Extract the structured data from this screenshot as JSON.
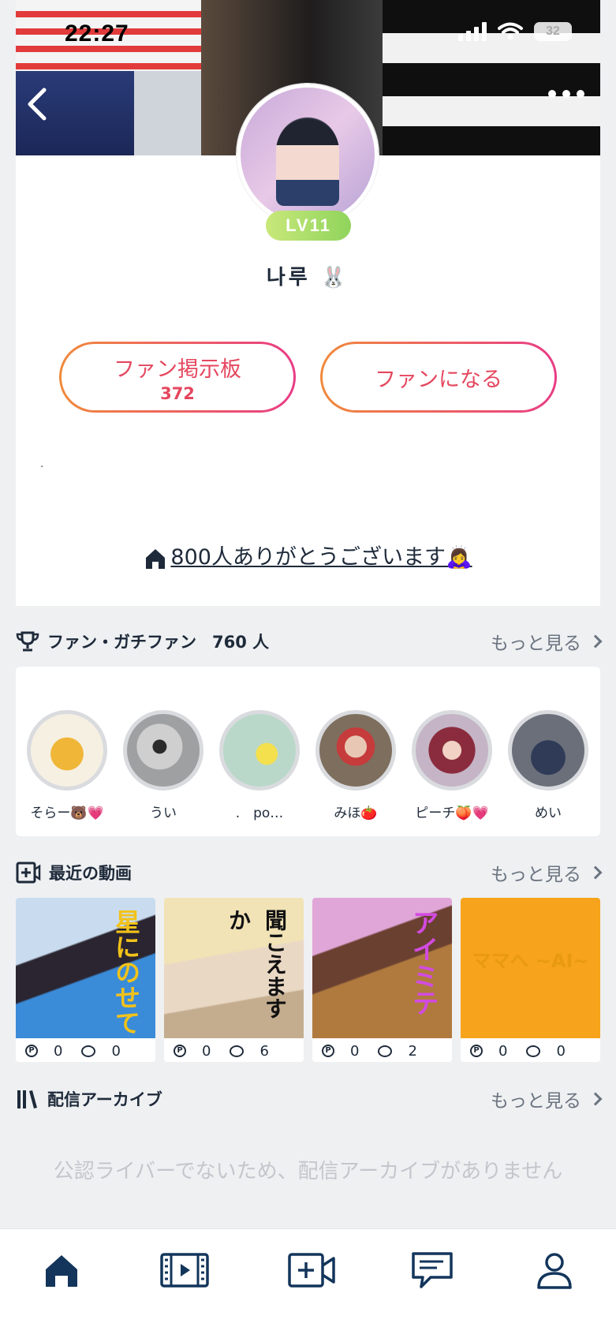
{
  "status_bar": {
    "time": "22:27",
    "battery": "32"
  },
  "profile": {
    "level": "LV11",
    "username": "나루 🐰",
    "fan_board_label": "ファン掲示板",
    "fan_board_count": "372",
    "become_fan_label": "ファンになる",
    "bio": ".",
    "announcement": "800人ありがとうございます🙇‍♀️"
  },
  "fans_section": {
    "title": "ファン・ガチファン",
    "count": "760 人",
    "more": "もっと見る",
    "fans": [
      {
        "name": "そらー🐻💗",
        "color": "#f6f0e3"
      },
      {
        "name": "うい",
        "color": "#9fa0a2"
      },
      {
        "name": ".　po…",
        "color": "#b9d8c9"
      },
      {
        "name": "みほ🍅",
        "color": "#7e6e5e"
      },
      {
        "name": "ピーチ🍑💗",
        "color": "#c5b4c6"
      },
      {
        "name": "めい",
        "color": "#6b6f7a"
      }
    ]
  },
  "videos_section": {
    "title": "最近の動画",
    "more": "もっと見る",
    "videos": [
      {
        "title": "星にのせて",
        "likes": "0",
        "comments": "0"
      },
      {
        "title": "聞こえますか",
        "likes": "0",
        "comments": "6"
      },
      {
        "title": "アイミテ",
        "likes": "0",
        "comments": "2"
      },
      {
        "title": "ママへ ~AI~",
        "likes": "0",
        "comments": "0"
      }
    ]
  },
  "archive_section": {
    "title": "配信アーカイブ",
    "more": "もっと見る",
    "empty_message": "公認ライバーでないため、配信アーカイブがありません"
  },
  "colors": {
    "accent_gradient_start": "#f08a3c",
    "accent_gradient_end": "#e93c86",
    "level_badge": "#a9dc6a",
    "primary_text": "#1e2a3a"
  }
}
